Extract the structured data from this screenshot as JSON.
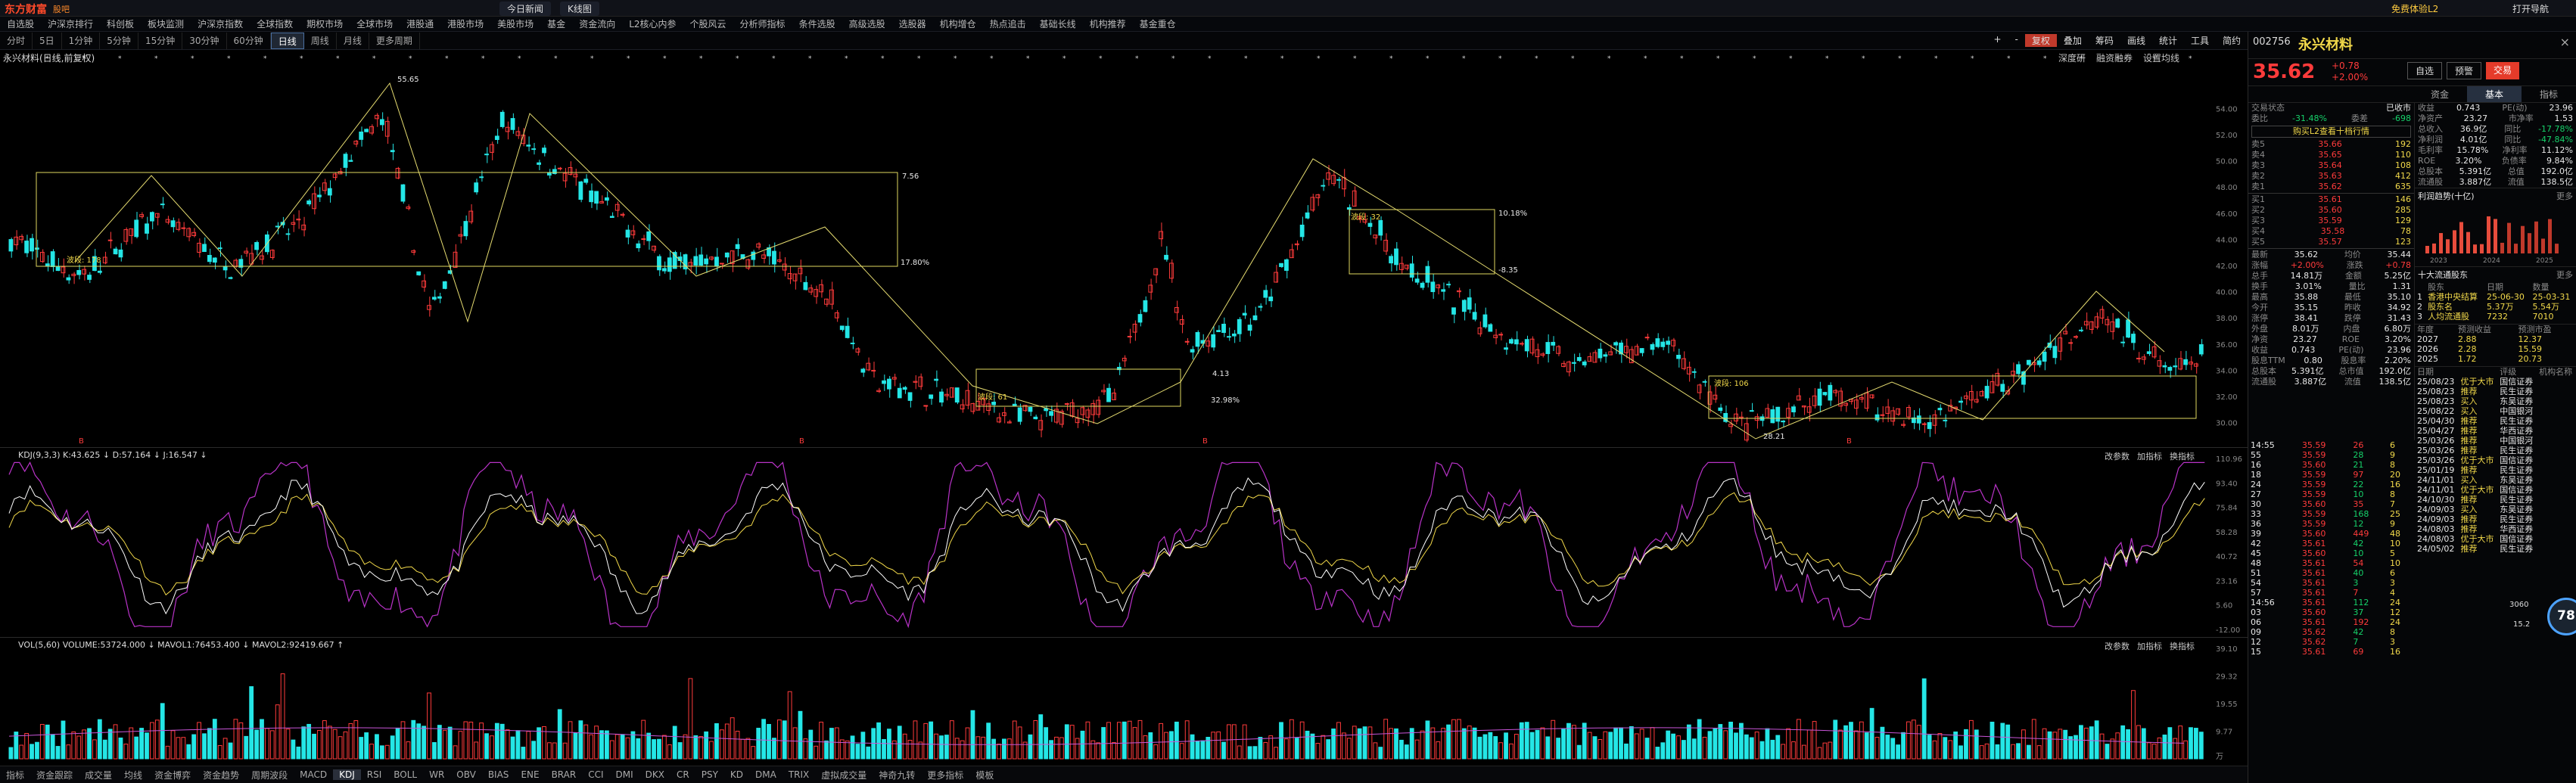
{
  "titlebar": {
    "logo": "东方财富",
    "logo_sub": "股吧",
    "tabs": [
      "今日新闻",
      "K线图"
    ],
    "right_items": [
      "打开导航",
      "免费体验L2"
    ]
  },
  "menu": [
    "自选股",
    "沪深京排行",
    "科创板",
    "板块监测",
    "沪深京指数",
    "全球指数",
    "期权市场",
    "全球市场",
    "港股通",
    "港股市场",
    "美股市场",
    "基金",
    "资金流向",
    "L2核心内参",
    "个股风云",
    "分析师指标",
    "条件选股",
    "高级选股",
    "选股器",
    "机构增仓",
    "热点追击",
    "基础长线",
    "机构推荐",
    "基金重仓"
  ],
  "periods": [
    "分时",
    "5日",
    "1分钟",
    "5分钟",
    "15分钟",
    "30分钟",
    "60分钟",
    "日线",
    "周线",
    "月线",
    "更多周期"
  ],
  "period_active": "日线",
  "toolbar": [
    "+",
    "-",
    "复权",
    "叠加",
    "筹码",
    "画线",
    "统计",
    "工具",
    "简约"
  ],
  "chart_title": "永兴材料(日线,前复权)",
  "chart_right_tools": [
    "深度研",
    "融资融券",
    "设置均线"
  ],
  "kdj_label": "KDJ(9,3,3)  K:43.625 ↓ D:57.164 ↓ J:16.547 ↓",
  "kdj_tools": [
    "改参数",
    "加指标",
    "换指标"
  ],
  "vol_label": "VOL(5,60)  VOLUME:53724.000 ↓ MAVOL1:76453.400 ↓ MAVOL2:92419.667 ↑",
  "vol_tools": [
    "改参数",
    "加指标",
    "换指标"
  ],
  "bottom": [
    "指标",
    "资金跟踪",
    "成交量",
    "均线",
    "资金博弈",
    "资金趋势",
    "周期波段",
    "MACD",
    "KDJ",
    "RSI",
    "BOLL",
    "WR",
    "OBV",
    "BIAS",
    "ENE",
    "BRAR",
    "CCI",
    "DMI",
    "DKX",
    "CR",
    "PSY",
    "KD",
    "DMA",
    "TRIX",
    "虚拟成交量",
    "神奇九转",
    "更多指标",
    "模板"
  ],
  "bottom_active": "KDJ",
  "stock": {
    "code": "002756",
    "name": "永兴材料",
    "price": "35.62",
    "change": "+0.78",
    "pct": "+2.00%"
  },
  "side_buttons": [
    "自选",
    "预警",
    "交易"
  ],
  "side_tabs": [
    "资金",
    "基本",
    "指标"
  ],
  "status_label": "交易状态",
  "status_value": "已收市",
  "weibi_label": "委比",
  "weibi": "-31.48%",
  "weicha_label": "委差",
  "weicha": "-698",
  "l2_banner": "购买L2查看十档行情",
  "asks": [
    {
      "l": "卖5",
      "p": "35.66",
      "v": "192"
    },
    {
      "l": "卖4",
      "p": "35.65",
      "v": "110"
    },
    {
      "l": "卖3",
      "p": "35.64",
      "v": "108"
    },
    {
      "l": "卖2",
      "p": "35.63",
      "v": "412"
    },
    {
      "l": "卖1",
      "p": "35.62",
      "v": "635"
    }
  ],
  "bids": [
    {
      "l": "买1",
      "p": "35.61",
      "v": "146"
    },
    {
      "l": "买2",
      "p": "35.60",
      "v": "285"
    },
    {
      "l": "买3",
      "p": "35.59",
      "v": "129"
    },
    {
      "l": "买4",
      "p": "35.58",
      "v": "78"
    },
    {
      "l": "买5",
      "p": "35.57",
      "v": "123"
    }
  ],
  "stats": [
    [
      "最新",
      "35.62",
      "均价",
      "35.44"
    ],
    [
      "涨幅",
      "+2.00%",
      "涨跌",
      "+0.78"
    ],
    [
      "总手",
      "14.81万",
      "金额",
      "5.25亿"
    ],
    [
      "换手",
      "3.01%",
      "量比",
      "1.31"
    ],
    [
      "最高",
      "35.88",
      "最低",
      "35.10"
    ],
    [
      "今开",
      "35.15",
      "昨收",
      "34.92"
    ],
    [
      "涨停",
      "38.41",
      "跌停",
      "31.43"
    ],
    [
      "外盘",
      "8.01万",
      "内盘",
      "6.80万"
    ],
    [
      "净资",
      "23.27",
      "ROE",
      "3.20%"
    ],
    [
      "收益",
      "0.743",
      "PE(动)",
      "23.96"
    ],
    [
      "股息TTM",
      "0.80",
      "股息率",
      "2.20%"
    ],
    [
      "总股本",
      "5.391亿",
      "总市值",
      "192.0亿"
    ],
    [
      "流通股",
      "3.887亿",
      "流值",
      "138.5亿"
    ]
  ],
  "fin": [
    [
      "收益",
      "0.743",
      "PE(动)",
      "23.96"
    ],
    [
      "净资产",
      "23.27",
      "市净率",
      "1.53"
    ],
    [
      "总收入",
      "36.9亿",
      "同比",
      "-17.78%"
    ],
    [
      "净利润",
      "4.01亿",
      "同比",
      "-47.84%"
    ],
    [
      "毛利率",
      "15.78%",
      "净利率",
      "11.12%"
    ],
    [
      "ROE",
      "3.20%",
      "负债率",
      "9.84%"
    ],
    [
      "总股本",
      "5.391亿",
      "总值",
      "192.0亿"
    ],
    [
      "流通股",
      "3.887亿",
      "流值",
      "138.5亿"
    ]
  ],
  "profit_label": "利润趋势(十亿)",
  "more": "更多",
  "profit_years": [
    "2023",
    "2024",
    "2025"
  ],
  "holders_label": "十大流通股东",
  "holders_head": [
    "",
    "股东",
    "日期",
    "数量"
  ],
  "holders": [
    [
      "1",
      "香港中央结算",
      "25-06-30",
      "25-03-31"
    ],
    [
      "2",
      "股东名",
      "5.37万",
      "5.54万"
    ],
    [
      "3",
      "人均流通股",
      "7232",
      "7010"
    ]
  ],
  "eps_head": [
    "年度",
    "预测收益",
    "预测市盈"
  ],
  "eps": [
    [
      "2027",
      "2.88",
      "12.37"
    ],
    [
      "2026",
      "2.28",
      "15.59"
    ],
    [
      "2025",
      "1.72",
      "20.73"
    ]
  ],
  "ratings_head": [
    "日期",
    "",
    "评级",
    "机构名称"
  ],
  "ratings": [
    [
      "25/08/23",
      "优于大市",
      "国信证券"
    ],
    [
      "25/08/23",
      "推荐",
      "民生证券"
    ],
    [
      "25/08/23",
      "买入",
      "东吴证券"
    ],
    [
      "25/08/22",
      "买入",
      "中国银河"
    ],
    [
      "25/04/30",
      "推荐",
      "民生证券"
    ],
    [
      "25/04/27",
      "推荐",
      "华西证券"
    ],
    [
      "25/03/26",
      "推荐",
      "中国银河"
    ],
    [
      "25/03/26",
      "推荐",
      "民生证券"
    ],
    [
      "25/03/26",
      "优于大市",
      "国信证券"
    ],
    [
      "25/01/19",
      "推荐",
      "民生证券"
    ],
    [
      "24/11/01",
      "买入",
      "东吴证券"
    ],
    [
      "24/11/01",
      "优于大市",
      "国信证券"
    ],
    [
      "24/10/30",
      "推荐",
      "民生证券"
    ],
    [
      "24/09/03",
      "买入",
      "东吴证券"
    ],
    [
      "24/09/03",
      "推荐",
      "民生证券"
    ],
    [
      "24/08/03",
      "推荐",
      "华西证券"
    ],
    [
      "24/08/03",
      "优于大市",
      "国信证券"
    ],
    [
      "24/05/02",
      "推荐",
      "民生证券"
    ]
  ],
  "ticks": [
    [
      "14:55",
      "35.59",
      "26",
      "6"
    ],
    [
      "55",
      "35.59",
      "28",
      "9"
    ],
    [
      "16",
      "35.60",
      "21",
      "8"
    ],
    [
      "18",
      "35.59",
      "97",
      "20"
    ],
    [
      "24",
      "35.59",
      "22",
      "16"
    ],
    [
      "27",
      "35.59",
      "10",
      "8"
    ],
    [
      "30",
      "35.60",
      "35",
      "7"
    ],
    [
      "33",
      "35.59",
      "168",
      "25"
    ],
    [
      "36",
      "35.59",
      "12",
      "9"
    ],
    [
      "39",
      "35.60",
      "449",
      "48"
    ],
    [
      "42",
      "35.61",
      "42",
      "10"
    ],
    [
      "45",
      "35.60",
      "10",
      "5"
    ],
    [
      "48",
      "35.61",
      "54",
      "10"
    ],
    [
      "51",
      "35.61",
      "40",
      "6"
    ],
    [
      "54",
      "35.61",
      "3",
      "3"
    ],
    [
      "57",
      "35.61",
      "7",
      "4"
    ],
    [
      "14:56",
      "35.61",
      "112",
      "24"
    ],
    [
      "03",
      "35.60",
      "37",
      "12"
    ],
    [
      "06",
      "35.61",
      "192",
      "24"
    ],
    [
      "09",
      "35.62",
      "42",
      "8"
    ],
    [
      "12",
      "35.62",
      "7",
      "3"
    ],
    [
      "15",
      "35.61",
      "69",
      "16"
    ]
  ],
  "gauge": "78",
  "gauge_sub": [
    "3060",
    "15.2"
  ],
  "y_main": [
    "54.00",
    "52.00",
    "50.00",
    "48.00",
    "46.00",
    "44.00",
    "42.00",
    "40.00",
    "38.00",
    "36.00",
    "34.00",
    "32.00",
    "30.00"
  ],
  "y_kdj": [
    "110.96",
    "93.40",
    "75.84",
    "58.28",
    "40.72",
    "23.16",
    "5.60",
    "-12.00"
  ],
  "y_vol": [
    "39.10",
    "29.32",
    "19.55",
    "9.77",
    "万"
  ],
  "x_labels": [
    "01",
    "02",
    "03",
    "12",
    "2024",
    "02",
    "03",
    "04",
    "05",
    "06",
    "07",
    "08",
    "09",
    "10",
    "11",
    "12",
    "2025",
    "02",
    "03",
    "04",
    "05",
    "06",
    "07",
    "08"
  ],
  "annotations": [
    "55.65",
    "7.56",
    "17.80%",
    "4.13",
    "32.98%",
    "10.18%",
    "-8.35",
    "28.21",
    "波段: 178",
    "波段: 32",
    "波段: 106",
    "波段: 61"
  ],
  "colors": {
    "up": "#ff3b3b",
    "down": "#16d16a",
    "kline_up": "#ff3b3b",
    "kline_down": "#24e6e6",
    "box": "#e0d860",
    "k": "#ffffff",
    "d": "#f2d94a",
    "j": "#b933c8",
    "ma": "#c955d8"
  }
}
